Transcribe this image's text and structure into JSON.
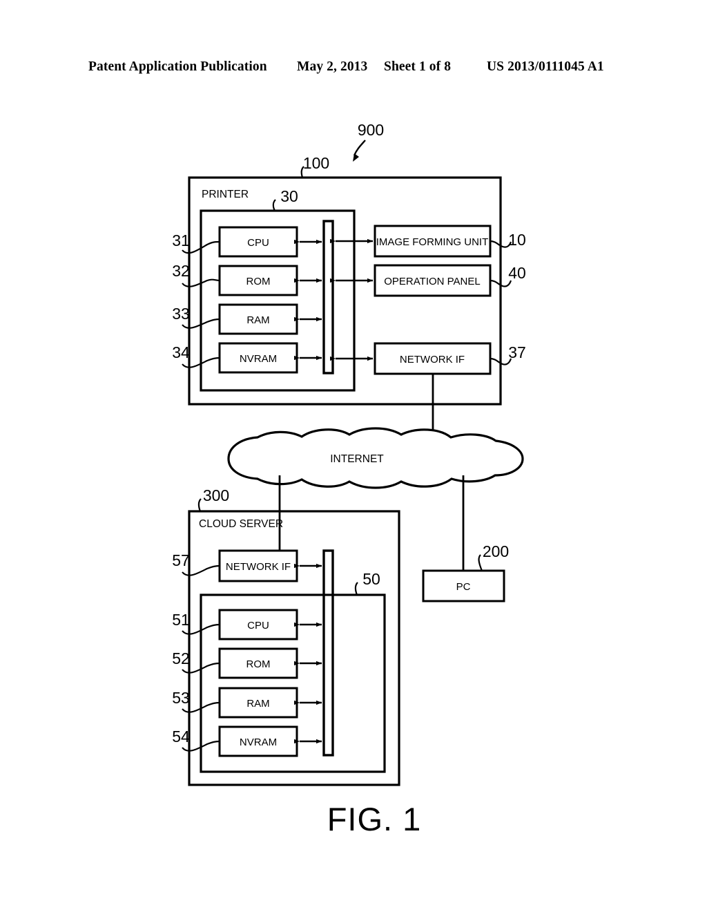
{
  "header": {
    "publication": "Patent Application Publication",
    "date": "May 2, 2013",
    "sheet": "Sheet 1 of 8",
    "number": "US 2013/0111045 A1"
  },
  "figure": {
    "caption": "FIG. 1",
    "system_ref": "900",
    "printer": {
      "title": "PRINTER",
      "ref": "100",
      "controller_ref": "30",
      "cpu": {
        "label": "CPU",
        "ref": "31"
      },
      "rom": {
        "label": "ROM",
        "ref": "32"
      },
      "ram": {
        "label": "RAM",
        "ref": "33"
      },
      "nvram": {
        "label": "NVRAM",
        "ref": "34"
      },
      "image_forming_unit": {
        "label": "IMAGE FORMING UNIT",
        "ref": "10"
      },
      "operation_panel": {
        "label": "OPERATION PANEL",
        "ref": "40"
      },
      "network_if": {
        "label": "NETWORK IF",
        "ref": "37"
      }
    },
    "internet": {
      "label": "INTERNET"
    },
    "cloud_server": {
      "title": "CLOUD SERVER",
      "ref": "300",
      "controller_ref": "50",
      "network_if": {
        "label": "NETWORK IF",
        "ref": "57"
      },
      "cpu": {
        "label": "CPU",
        "ref": "51"
      },
      "rom": {
        "label": "ROM",
        "ref": "52"
      },
      "ram": {
        "label": "RAM",
        "ref": "53"
      },
      "nvram": {
        "label": "NVRAM",
        "ref": "54"
      }
    },
    "pc": {
      "label": "PC",
      "ref": "200"
    }
  },
  "colors": {
    "ink": "#000000",
    "paper": "#ffffff"
  }
}
